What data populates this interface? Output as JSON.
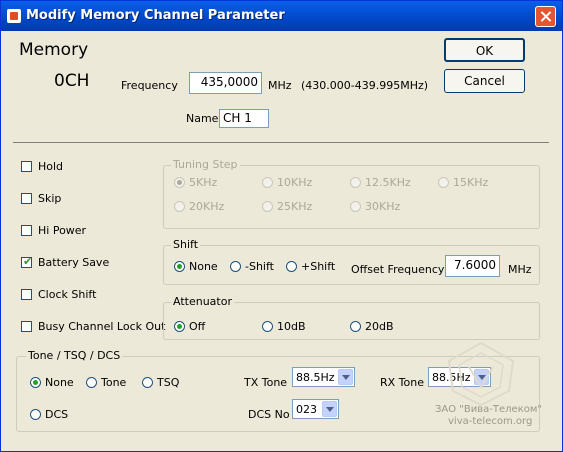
{
  "window": {
    "title": "Modify Memory Channel Parameter"
  },
  "memory": {
    "heading": "Memory",
    "channel": "0CH"
  },
  "frequency": {
    "label": "Frequency",
    "value": "435,0000",
    "unit": "MHz",
    "range": "(430.000-439.995MHz)"
  },
  "name": {
    "label": "Name",
    "value": "CH 1"
  },
  "buttons": {
    "ok": "OK",
    "cancel": "Cancel"
  },
  "checkboxes": [
    {
      "label": "Hold",
      "checked": false
    },
    {
      "label": "Skip",
      "checked": false
    },
    {
      "label": "Hi Power",
      "checked": false
    },
    {
      "label": "Battery Save",
      "checked": true
    },
    {
      "label": "Clock Shift",
      "checked": false
    },
    {
      "label": "Busy Channel Lock Out",
      "checked": false
    }
  ],
  "tuning_step": {
    "title": "Tuning Step",
    "options": [
      "5KHz",
      "10KHz",
      "12.5KHz",
      "15KHz",
      "20KHz",
      "25KHz",
      "30KHz"
    ],
    "selected": "5KHz",
    "enabled": false
  },
  "shift": {
    "title": "Shift",
    "options": [
      "None",
      "-Shift",
      "+Shift"
    ],
    "selected": "None",
    "offset_label": "Offset Frequency",
    "offset_value": "7.6000",
    "offset_unit": "MHz"
  },
  "attenuator": {
    "title": "Attenuator",
    "options": [
      "Off",
      "10dB",
      "20dB"
    ],
    "selected": "Off"
  },
  "tone": {
    "title": "Tone / TSQ / DCS",
    "options": [
      "None",
      "Tone",
      "TSQ",
      "DCS"
    ],
    "selected": "None",
    "tx_label": "TX Tone",
    "tx_value": "88.5Hz",
    "rx_label": "RX Tone",
    "rx_value": "88.5Hz",
    "dcs_label": "DCS No",
    "dcs_value": "023"
  },
  "watermark": {
    "line1": "ЗАО \"Вива-Телеком\"",
    "line2": "viva-telecom.org"
  }
}
